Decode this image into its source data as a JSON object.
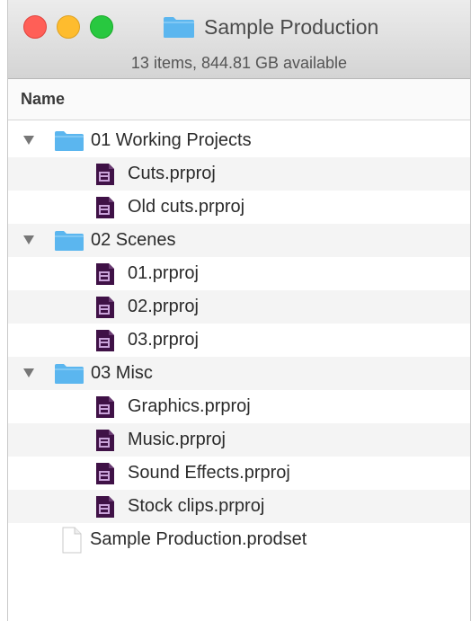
{
  "window": {
    "title": "Sample Production",
    "status": "13 items, 844.81 GB available",
    "column_name": "Name"
  },
  "colors": {
    "folder_blue": "#5bb6ef",
    "project_purple": "#3f1146",
    "project_text": "#c9a3d9"
  },
  "icons": {
    "folder": "folder-icon",
    "project_file": "premiere-project-icon",
    "document": "document-icon",
    "disclosure": "disclosure-triangle-icon"
  },
  "rows": [
    {
      "kind": "folder",
      "label": "01 Working Projects",
      "expanded": true
    },
    {
      "kind": "file",
      "label": "Cuts.prproj"
    },
    {
      "kind": "file",
      "label": "Old cuts.prproj"
    },
    {
      "kind": "folder",
      "label": "02 Scenes",
      "expanded": true
    },
    {
      "kind": "file",
      "label": "01.prproj"
    },
    {
      "kind": "file",
      "label": "02.prproj"
    },
    {
      "kind": "file",
      "label": "03.prproj"
    },
    {
      "kind": "folder",
      "label": "03 Misc",
      "expanded": true
    },
    {
      "kind": "file",
      "label": "Graphics.prproj"
    },
    {
      "kind": "file",
      "label": "Music.prproj"
    },
    {
      "kind": "file",
      "label": "Sound Effects.prproj"
    },
    {
      "kind": "file",
      "label": "Stock clips.prproj"
    },
    {
      "kind": "doc",
      "label": "Sample Production.prodset"
    }
  ]
}
